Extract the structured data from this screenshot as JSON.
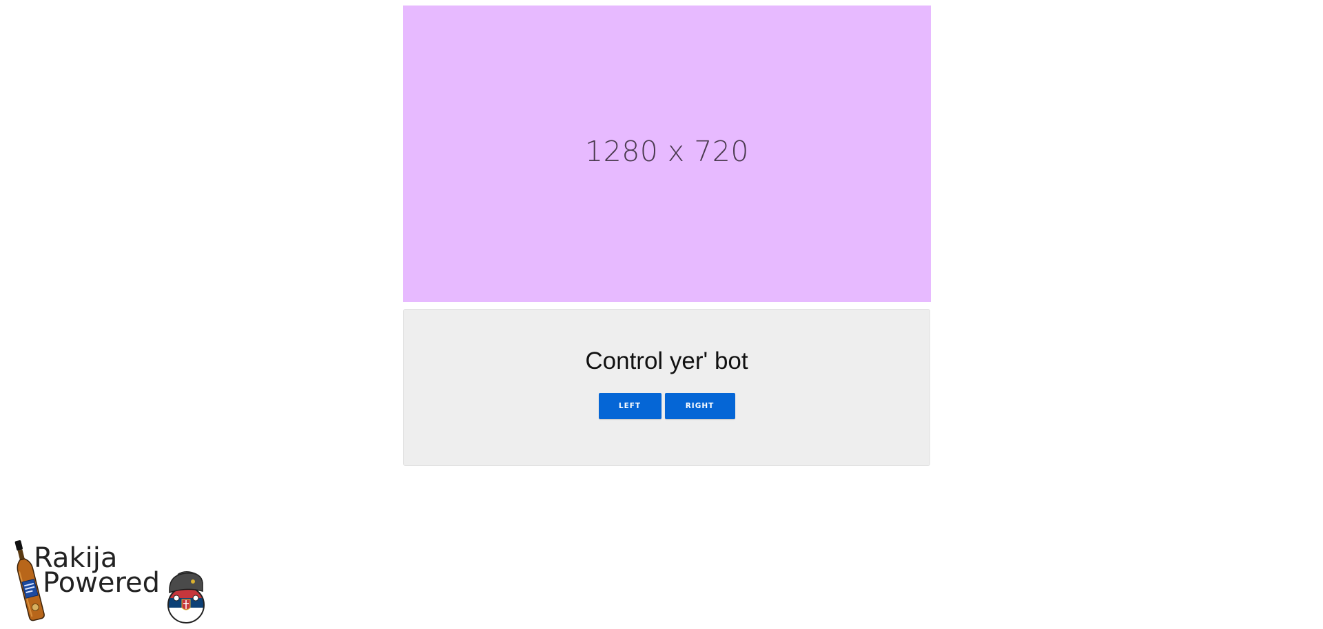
{
  "video": {
    "placeholder_text": "1280 x 720",
    "background_color": "#e7baff"
  },
  "controls": {
    "title": "Control yer' bot",
    "left_label": "LEFT",
    "right_label": "RIGHT",
    "button_color": "#0566d6"
  },
  "badge": {
    "line1": "Rakija",
    "line2": "Powered",
    "bottle_icon": "rakija-bottle-icon",
    "ball_icon": "serbia-countryball-icon"
  }
}
